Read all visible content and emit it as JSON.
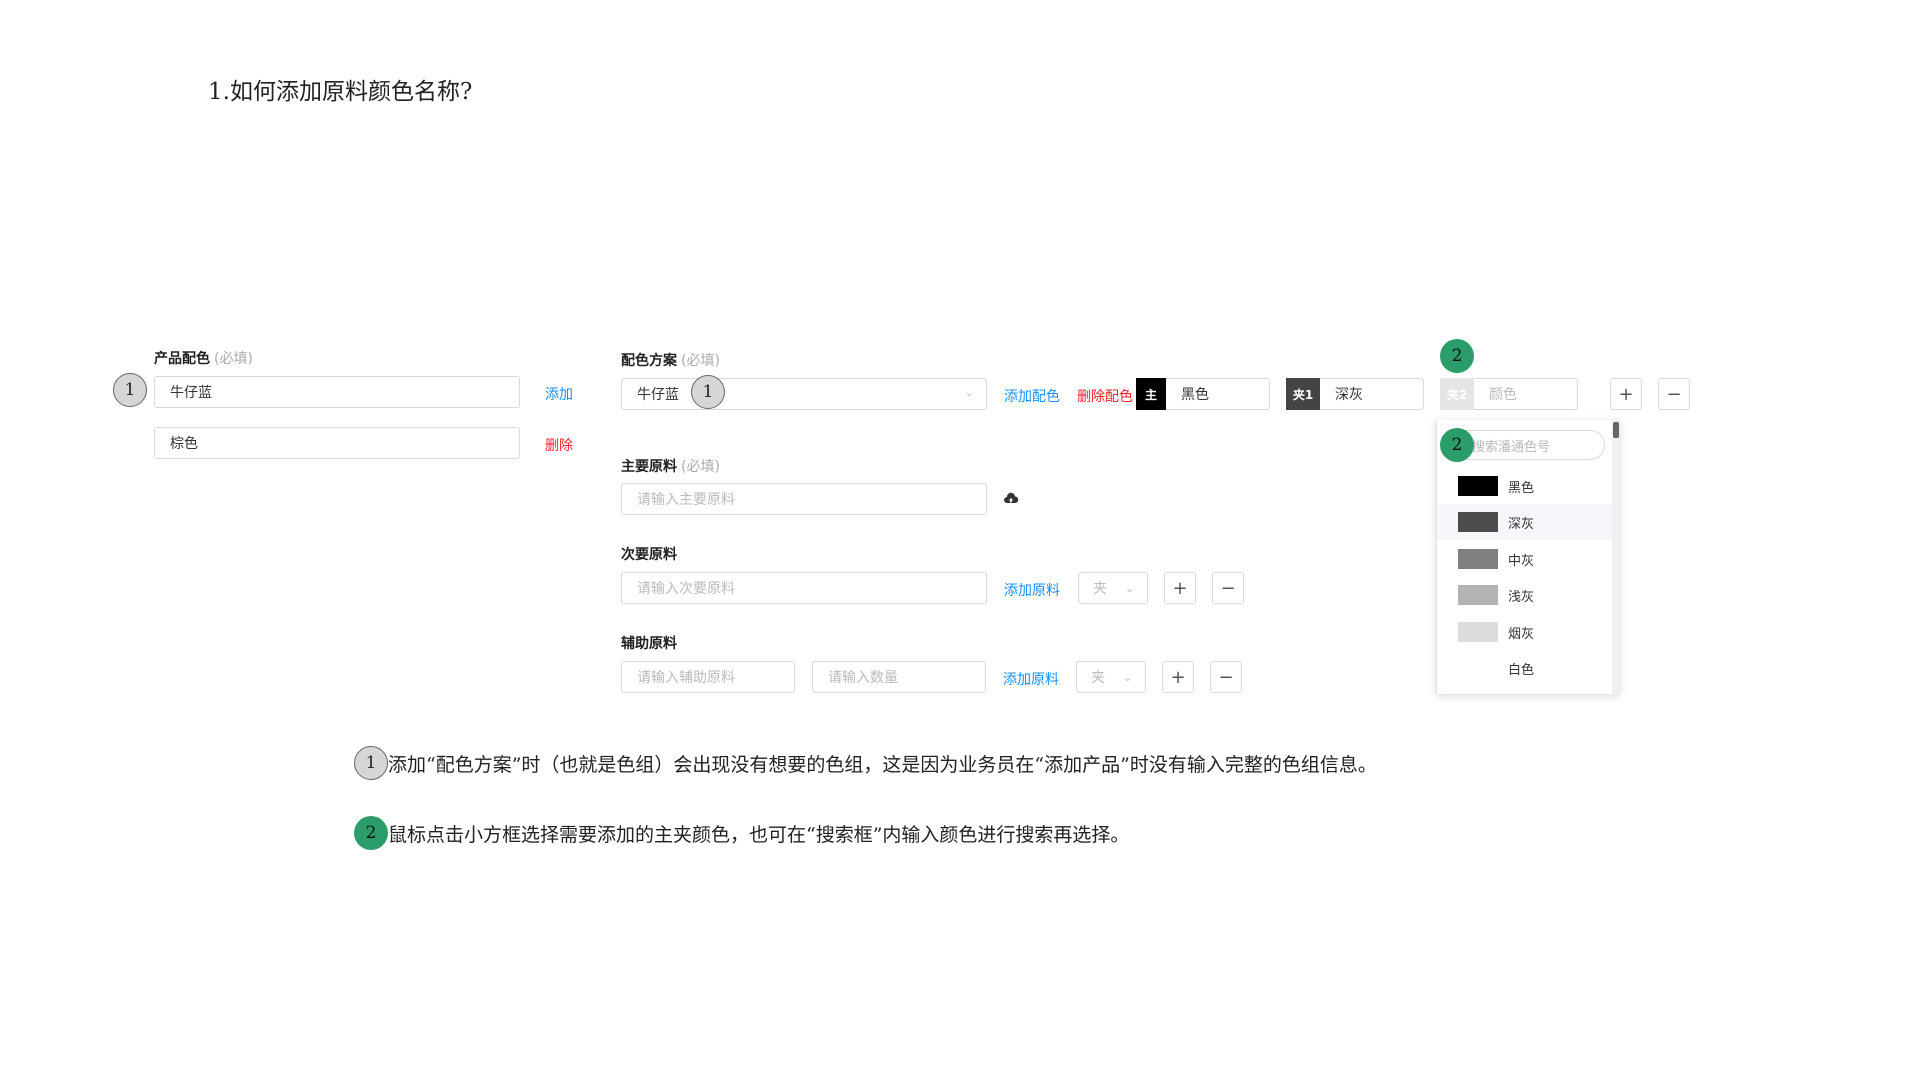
{
  "title": "1.如何添加原料颜色名称?",
  "product": {
    "label": "产品配色",
    "required": "(必填)",
    "color1": "牛仔蓝",
    "color2": "棕色",
    "add": "添加",
    "remove": "删除"
  },
  "scheme": {
    "label": "配色方案",
    "required": "(必填)",
    "value": "牛仔蓝",
    "add_scheme": "添加配色",
    "remove_scheme": "删除配色",
    "tag_main": "主",
    "main_color": "黑色",
    "tag_mid1": "夹1",
    "mid1_color": "深灰",
    "tag_mid2": "夹2",
    "mid2_placeholder": "颜色"
  },
  "main_material": {
    "label": "主要原料",
    "required": "(必填)",
    "placeholder": "请输入主要原料"
  },
  "secondary_material": {
    "label": "次要原料",
    "placeholder": "请输入次要原料",
    "add": "添加原料",
    "select": "夹"
  },
  "aux_material": {
    "label": "辅助原料",
    "placeholder": "请输入辅助原料",
    "qty_placeholder": "请输入数量",
    "add": "添加原料",
    "select": "夹"
  },
  "dropdown": {
    "search_placeholder": "搜索潘通色号",
    "items": [
      {
        "name": "黑色",
        "color": "#000000"
      },
      {
        "name": "深灰",
        "color": "#4d4d4d"
      },
      {
        "name": "中灰",
        "color": "#808080"
      },
      {
        "name": "浅灰",
        "color": "#b3b3b3"
      },
      {
        "name": "烟灰",
        "color": "#dddddd"
      },
      {
        "name": "白色",
        "color": "#ffffff"
      }
    ]
  },
  "markers": {
    "one": "1",
    "two": "2"
  },
  "notes": {
    "note1": "添加“配色方案”时（也就是色组）会出现没有想要的色组，这是因为业务员在“添加产品”时没有输入完整的色组信息。",
    "note2": "鼠标点击小方框选择需要添加的主夹颜色，也可在“搜索框”内输入颜色进行搜索再选择。"
  },
  "colors": {
    "accent_blue": "#1890ff",
    "danger_red": "#f5222d",
    "marker_green": "#2a9d6a"
  }
}
